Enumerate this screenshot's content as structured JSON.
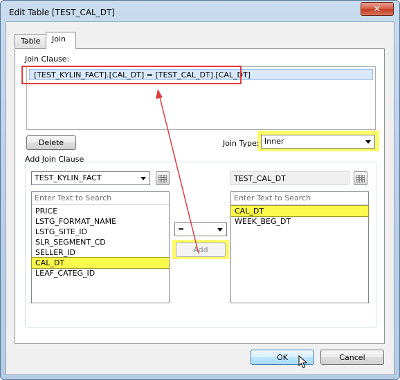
{
  "window": {
    "title": "Edit Table [TEST_CAL_DT]",
    "close_glyph": "✕"
  },
  "tabs": [
    {
      "label": "Table"
    },
    {
      "label": "Join"
    }
  ],
  "join_clause": {
    "label": "Join Clause:",
    "rows": [
      "[TEST_KYLIN_FACT].[CAL_DT] = [TEST_CAL_DT].[CAL_DT]"
    ]
  },
  "delete_button": "Delete",
  "join_type": {
    "label": "Join Type:",
    "value": "Inner"
  },
  "add_join_clause": {
    "label": "Add Join Clause",
    "left": {
      "table": "TEST_KYLIN_FACT",
      "search_placeholder": "Enter Text to Search",
      "columns": [
        "PRICE",
        "LSTG_FORMAT_NAME",
        "LSTG_SITE_ID",
        "SLR_SEGMENT_CD",
        "SELLER_ID",
        "CAL_DT",
        "LEAF_CATEG_ID"
      ],
      "selected": "CAL_DT"
    },
    "operator": "=",
    "add_button": "Add",
    "right": {
      "table": "TEST_CAL_DT",
      "search_placeholder": "Enter Text to Search",
      "columns": [
        "CAL_DT",
        "WEEK_BEG_DT"
      ],
      "selected": "CAL_DT"
    }
  },
  "footer": {
    "ok": "OK",
    "cancel": "Cancel"
  },
  "colors": {
    "highlight": "#fbf94c",
    "annotation": "#e03a3a",
    "title_bar": "#bcd2ea"
  },
  "icons": [
    "close-icon",
    "list-picker-icon",
    "chevron-down-icon",
    "mouse-cursor-icon",
    "annotation-arrow"
  ]
}
